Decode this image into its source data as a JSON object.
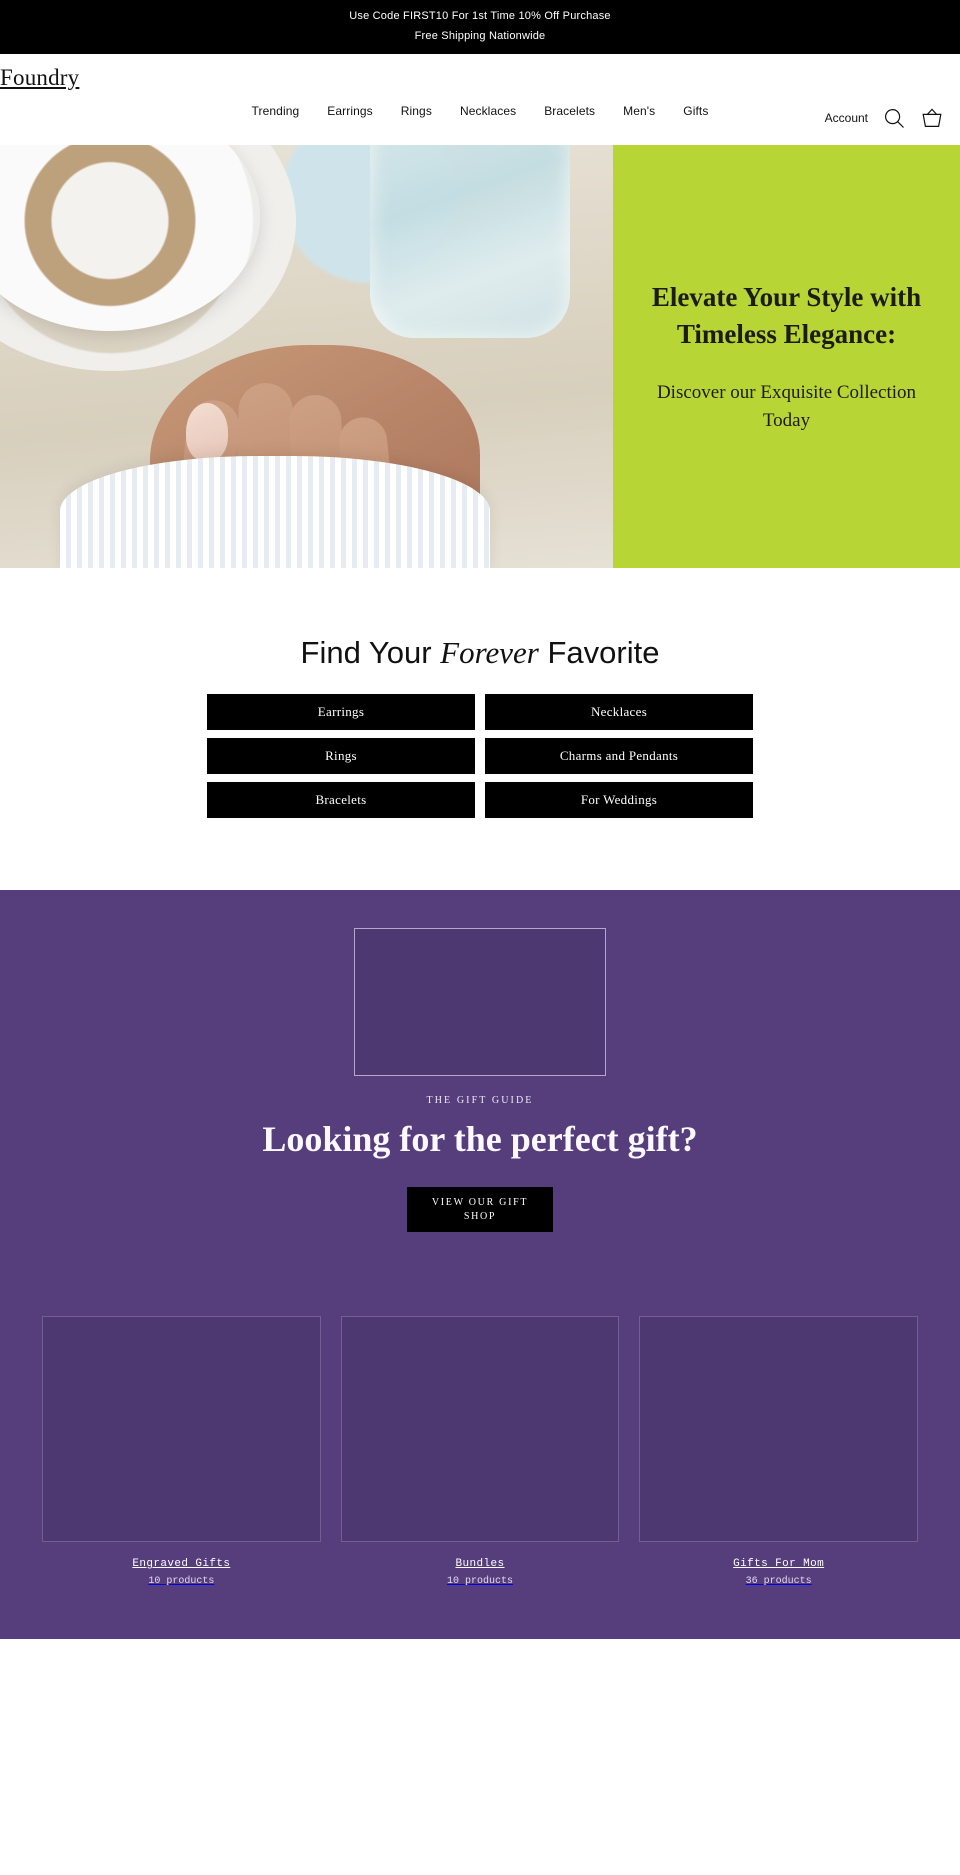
{
  "announcement": {
    "lines": [
      "Use Code FIRST10 For 1st Time 10% Off Purchase",
      "Free Shipping Nationwide"
    ]
  },
  "header": {
    "logo": "Foundry",
    "nav": [
      {
        "label": "Trending"
      },
      {
        "label": "Earrings"
      },
      {
        "label": "Rings"
      },
      {
        "label": "Necklaces"
      },
      {
        "label": "Bracelets"
      },
      {
        "label": "Men's"
      },
      {
        "label": "Gifts"
      }
    ],
    "account_label": "Account",
    "search_icon": "search-icon",
    "cart_icon": "shopping-basket-icon"
  },
  "hero": {
    "title": "Elevate Your Style with Timeless Elegance:",
    "subtitle": "Discover our Exquisite Collection Today",
    "panel_color": "#b7d636"
  },
  "collections": {
    "title_before": "Find Your ",
    "title_emphasis": "Forever",
    "title_after": " Favorite",
    "categories": [
      {
        "label": "Earrings"
      },
      {
        "label": "Necklaces"
      },
      {
        "label": "Rings"
      },
      {
        "label": "Charms and Pendants"
      },
      {
        "label": "Bracelets"
      },
      {
        "label": "For Weddings"
      }
    ]
  },
  "gift_guide": {
    "eyebrow": "THE GIFT GUIDE",
    "heading": "Looking for the perfect gift?",
    "cta_line1": "VIEW OUR GIFT",
    "cta_line2": "SHOP",
    "background_color": "#563d7c"
  },
  "collection_cards": [
    {
      "title": "Engraved Gifts",
      "count": "10 products"
    },
    {
      "title": "Bundles",
      "count": "10 products"
    },
    {
      "title": "Gifts For Mom",
      "count": "36 products"
    }
  ]
}
